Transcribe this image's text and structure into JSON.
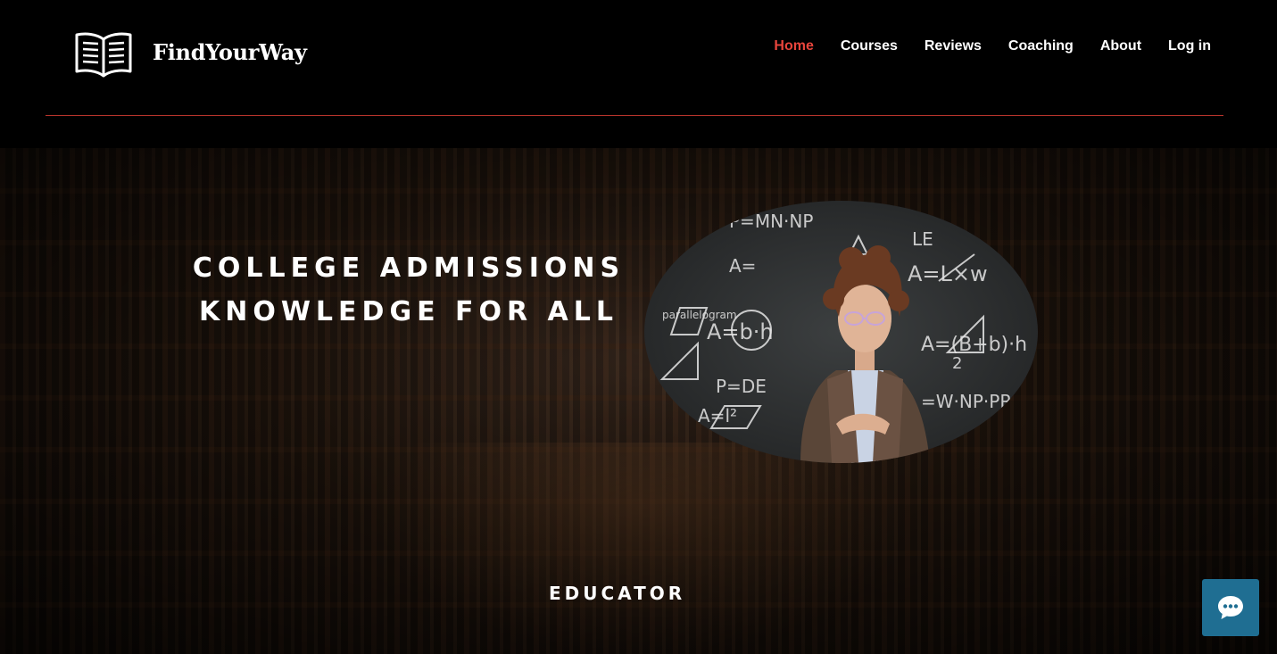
{
  "brand": {
    "name": "FindYourWay",
    "logo_icon": "open-book-icon"
  },
  "nav": {
    "items": [
      {
        "label": "Home",
        "active": true
      },
      {
        "label": "Courses",
        "active": false
      },
      {
        "label": "Reviews",
        "active": false
      },
      {
        "label": "Coaching",
        "active": false
      },
      {
        "label": "About",
        "active": false
      },
      {
        "label": "Log in",
        "active": false
      }
    ]
  },
  "hero": {
    "headline_line1": "COLLEGE ADMISSIONS",
    "headline_line2": "KNOWLEDGE FOR ALL",
    "subheading": "EDUCATOR",
    "background": "library-bookshelves-image",
    "photo": "educator-at-chalkboard-image"
  },
  "chat_widget": {
    "icon": "chat-bubble-icon"
  },
  "colors": {
    "accent": "#e8453c",
    "divider": "#b8342c",
    "chat_button": "#1f6e92",
    "header_bg": "#000000"
  }
}
